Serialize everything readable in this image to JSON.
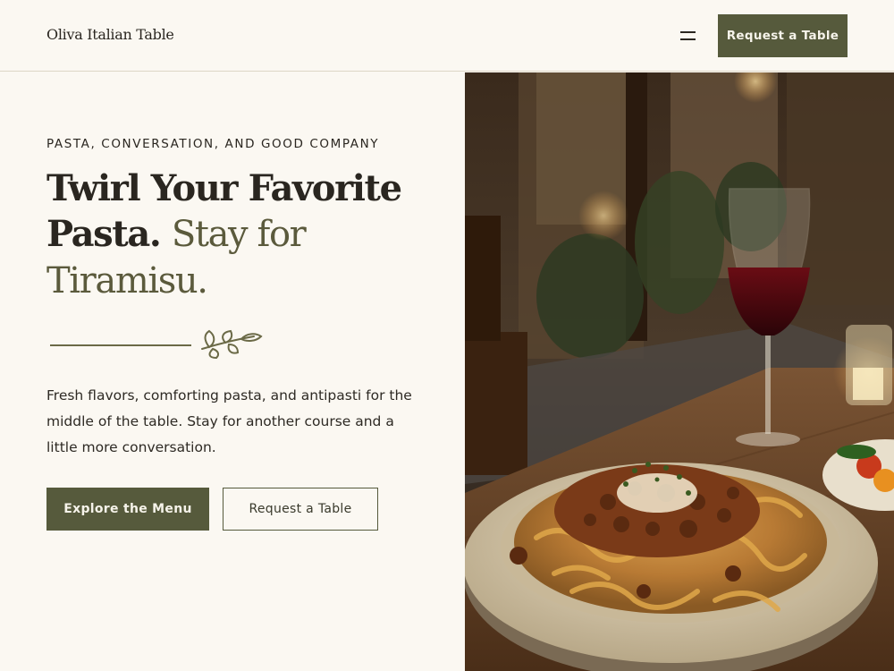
{
  "header": {
    "brand": "Oliva Italian Table",
    "cta_label": "Request a Table",
    "menu_icon": "hamburger-menu-icon"
  },
  "hero": {
    "eyebrow": "PASTA, CONVERSATION, AND GOOD COMPANY",
    "headline_part1": "Twirl Your Favorite Pasta.",
    "headline_part2": "Stay for Tiramisu.",
    "divider_icon": "olive-branch-icon",
    "body": "Fresh flavors, comforting pasta, and antipasti for the middle of the table. Stay for another course and a little more conversation.",
    "primary_button": "Explore the Menu",
    "secondary_button": "Request a Table"
  },
  "colors": {
    "background": "#fbf8f2",
    "accent": "#565a3c",
    "text": "#2a2620"
  }
}
